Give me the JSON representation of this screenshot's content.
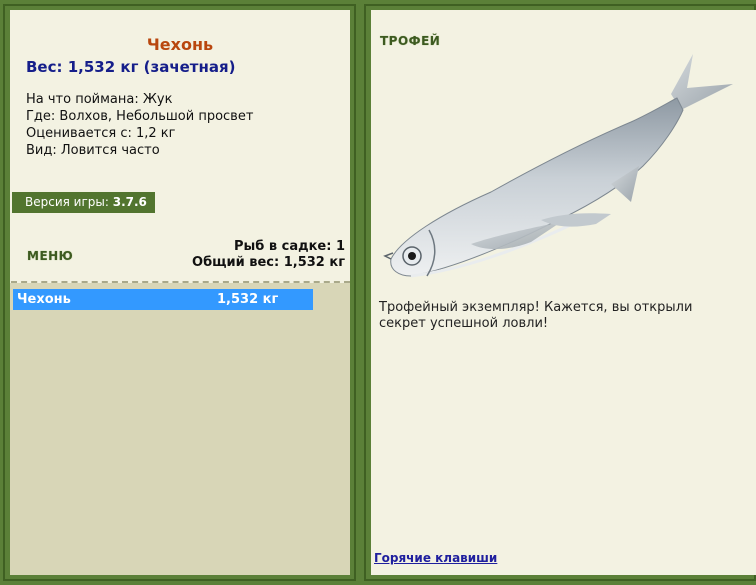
{
  "fish": {
    "name": "Чехонь",
    "weight_line": "Вес: 1,532 кг (зачетная)",
    "bait": "На что поймана: Жук",
    "location": "Где: Волхов, Небольшой просвет",
    "appraised": "Оценивается с: 1,2 кг",
    "kind": "Вид: Ловится часто"
  },
  "version": {
    "label": "Версия игры:",
    "value": "3.7.6"
  },
  "menu_label": "МЕНЮ",
  "stats": {
    "count_line": "Рыб в садке: 1",
    "total_line": "Общий вес: 1,532 кг"
  },
  "keepnet": [
    {
      "name": "Чехонь",
      "weight": "1,532 кг"
    }
  ],
  "trophy": {
    "label": "ТРОФЕЙ",
    "text": "Трофейный экземпляр! Кажется, вы открыли секрет успешной ловли!"
  },
  "hotkeys_label": "Горячие клавиши",
  "colors": {
    "background": "#5b8038",
    "panel": "#f3f2e2",
    "title": "#b9470e",
    "weight": "#151e8a",
    "selected_row": "#3399ff",
    "version_bar": "#52752f"
  }
}
